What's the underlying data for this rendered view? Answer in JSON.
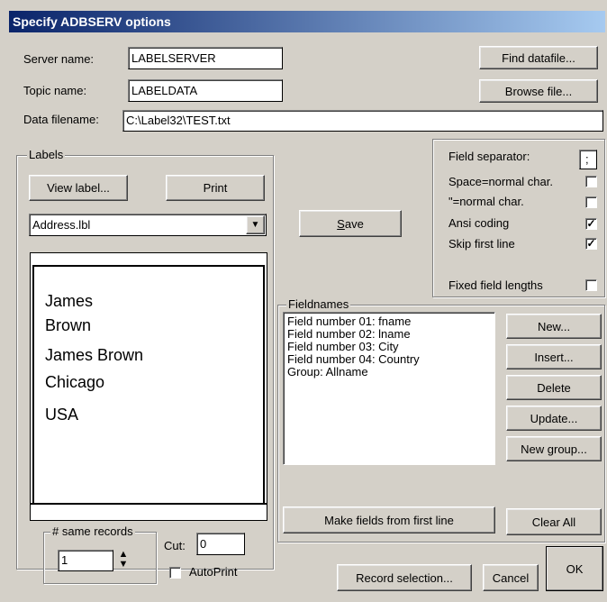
{
  "window": {
    "title": "Specify ADBSERV options"
  },
  "server": {
    "label": "Server name:",
    "value": "LABELSERVER"
  },
  "topic": {
    "label": "Topic name:",
    "value": "LABELDATA"
  },
  "datafile": {
    "label": "Data filename:",
    "value": "C:\\Label32\\TEST.txt"
  },
  "buttons": {
    "find_datafile": "Find datafile...",
    "browse_file": "Browse file...",
    "view_label": "View label...",
    "print": "Print",
    "save_prefix": "S",
    "save_rest": "ave",
    "new": "New...",
    "insert": "Insert...",
    "delete": "Delete",
    "update": "Update...",
    "new_group": "New group...",
    "make_fields": "Make fields from first line",
    "clear_all": "Clear All",
    "record_selection": "Record selection...",
    "cancel": "Cancel",
    "ok": "OK"
  },
  "labels_group": {
    "title": "Labels",
    "selected_label": "Address.lbl",
    "preview_lines": [
      "James",
      "Brown",
      "James Brown",
      "Chicago",
      "USA"
    ]
  },
  "options": {
    "field_separator": {
      "label": "Field separator:",
      "value": ";"
    },
    "space_normal": {
      "label": "Space=normal char.",
      "checked": false
    },
    "quote_normal": {
      "label": "\"=normal char.",
      "checked": false
    },
    "ansi_coding": {
      "label": "Ansi coding",
      "checked": true
    },
    "skip_first_line": {
      "label": "Skip first line",
      "checked": true
    },
    "fixed_field_lengths": {
      "label": "Fixed field lengths",
      "checked": false
    }
  },
  "fieldnames": {
    "title": "Fieldnames",
    "items": [
      "Field number 01: fname",
      "Field number 02: lname",
      "Field number 03: City",
      "Field number 04: Country",
      "Group: Allname"
    ]
  },
  "same_records": {
    "title": "# same records",
    "value": "1"
  },
  "cut": {
    "label": "Cut:",
    "value": "0"
  },
  "autoprint": {
    "label": "AutoPrint",
    "checked": false
  },
  "colors": {
    "title_start": "#0a246a",
    "title_end": "#a6caf0",
    "face": "#d4d0c8"
  }
}
